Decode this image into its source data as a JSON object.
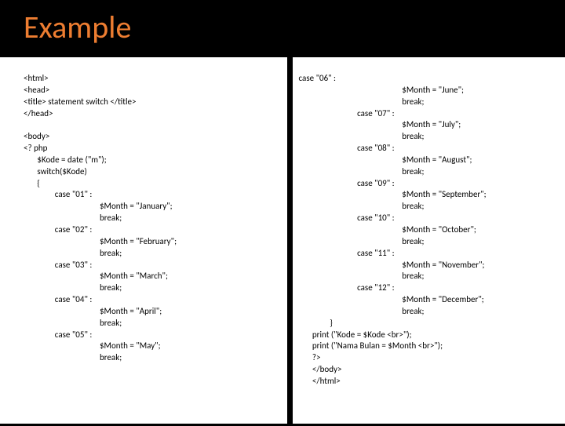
{
  "title": "Example",
  "code_left": "<html>\n<head>\n<title> statement switch </title>\n</head>\n\n<body>\n<? php\n       $Kode = date (\"m\");\n       switch($Kode)\n       {\n                case \"01\" :\n                                       $Month = \"January\";\n                                       break;\n                case \"02\" :\n                                       $Month = \"February\";\n                                       break;\n                case \"03\" :\n                                       $Month = \"March\";\n                                       break;\n                case \"04\" :\n                                       $Month = \"April\";\n                                       break;\n                case \"05\" :\n                                       $Month = \"May\";\n                                       break;",
  "code_right": "case \"06\" :\n                                                     $Month = \"June\";\n                                                     break;\n                              case \"07\" :\n                                                     $Month = \"July\";\n                                                     break;\n                              case \"08\" :\n                                                     $Month = \"August\";\n                                                     break;\n                              case \"09\" :\n                                                     $Month = \"September\";\n                                                     break;\n                              case \"10\" :\n                                                     $Month = \"October\";\n                                                     break;\n                              case \"11\" :\n                                                     $Month = \"November\";\n                                                     break;\n                              case \"12\" :\n                                                     $Month = \"December\";\n                                                     break;\n                }\n       print (\"Kode = $Kode <br>\");\n       print (\"Nama Bulan = $Month <br>\");\n       ?>\n       </body>\n       </html>"
}
